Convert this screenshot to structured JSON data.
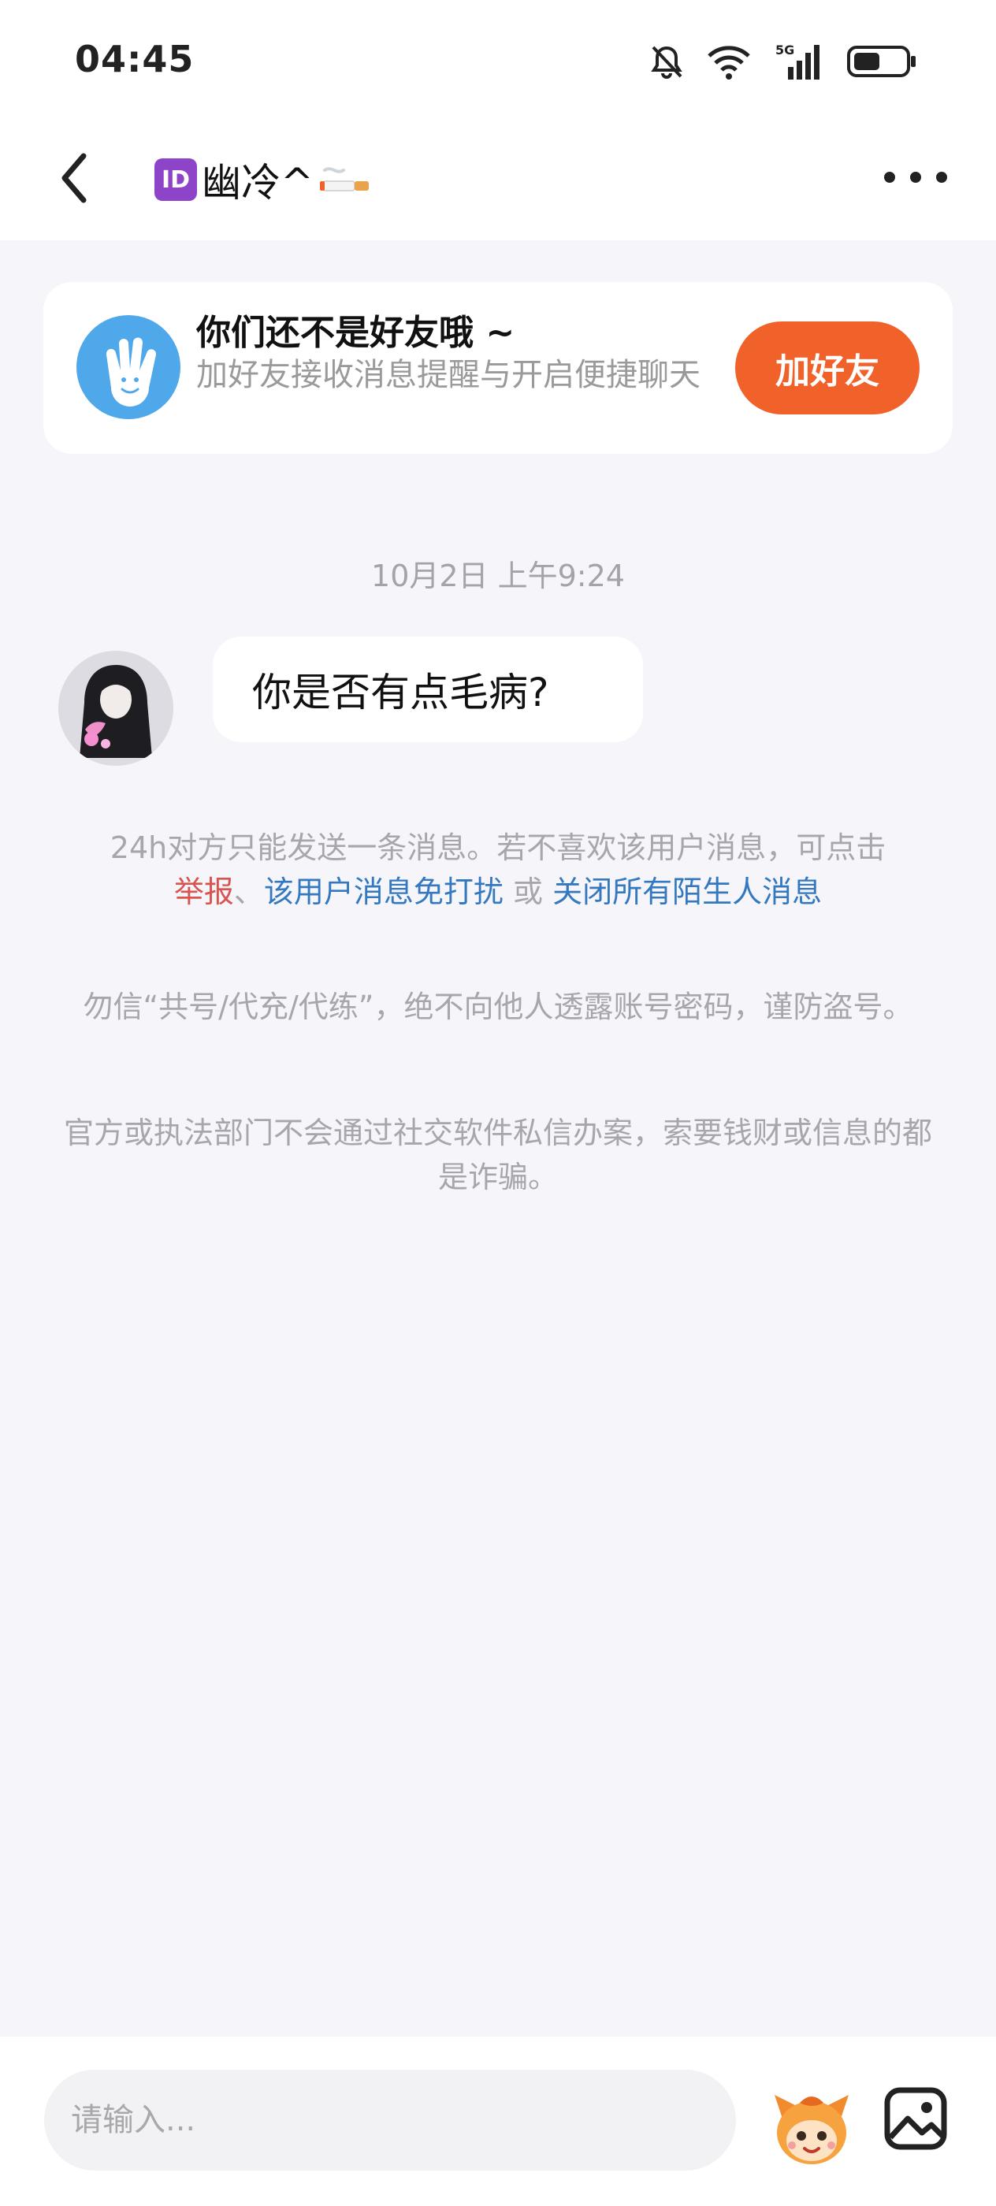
{
  "status_bar": {
    "time": "04:45",
    "network": "5G"
  },
  "header": {
    "id_badge": "ID",
    "title": "幽冷^"
  },
  "friend_banner": {
    "title": "你们还不是好友哦 ~",
    "subtitle": "加好友接收消息提醒与开启便捷聊天",
    "add_button": "加好友"
  },
  "chat": {
    "timestamp": "10月2日 上午9:24",
    "messages": [
      {
        "text": "你是否有点毛病?"
      }
    ]
  },
  "notices": {
    "limit_text": "24h对方只能发送一条消息。若不喜欢该用户消息，可点击",
    "report_link": "举报",
    "separator": "、",
    "mute_link": "该用户消息免打扰",
    "or_text": " 或 ",
    "close_link": "关闭所有陌生人消息",
    "warning_1": "勿信“共号/代充/代练”，绝不向他人透露账号密码，谨防盗号。",
    "warning_2": "官方或执法部门不会通过社交软件私信办案，索要钱财或信息的都是诈骗。"
  },
  "input_bar": {
    "placeholder": "请输入..."
  },
  "colors": {
    "accent": "#f0622a",
    "link_blue": "#3478c0",
    "link_red": "#d9534f",
    "id_purple": "#8e44c9"
  }
}
